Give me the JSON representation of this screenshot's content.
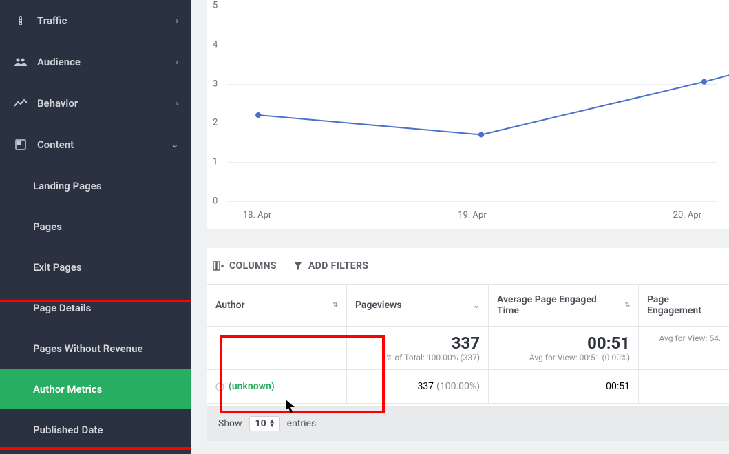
{
  "sidebar": {
    "items": [
      {
        "label": "Traffic",
        "expandable": true,
        "expanded": false
      },
      {
        "label": "Audience",
        "expandable": true,
        "expanded": false
      },
      {
        "label": "Behavior",
        "expandable": true,
        "expanded": false
      },
      {
        "label": "Content",
        "expandable": true,
        "expanded": true
      }
    ],
    "sub": [
      {
        "label": "Landing Pages"
      },
      {
        "label": "Pages"
      },
      {
        "label": "Exit Pages"
      },
      {
        "label": "Page Details"
      },
      {
        "label": "Pages Without Revenue"
      },
      {
        "label": "Author Metrics",
        "active": true
      },
      {
        "label": "Published Date"
      }
    ]
  },
  "toolbar": {
    "columns_label": "COLUMNS",
    "filters_label": "ADD FILTERS"
  },
  "table": {
    "headers": [
      "Author",
      "Pageviews",
      "Average Page Engaged Time",
      "Page Engagement"
    ],
    "summary": {
      "pageviews": {
        "big": "337",
        "sub": "% of Total: 100.00% (337)"
      },
      "avg_time": {
        "big": "00:51",
        "sub": "Avg for View: 00:51 (0.00%)"
      },
      "engagement": {
        "big": "",
        "sub": "Avg for View: 54."
      }
    },
    "rows": [
      {
        "author": "(unknown)",
        "pageviews": "337",
        "pageviews_pct": "(100.00%)",
        "avg_time": "00:51"
      }
    ],
    "footer": {
      "show": "Show",
      "value": "10",
      "entries": "entries"
    }
  },
  "chart_data": {
    "type": "line",
    "title": "",
    "xlabel": "",
    "ylabel": "",
    "ylim": [
      0,
      5
    ],
    "yticks": [
      0,
      1,
      2,
      3,
      4,
      5
    ],
    "categories": [
      "18. Apr",
      "19. Apr",
      "20. Apr"
    ],
    "series": [
      {
        "name": "",
        "values": [
          2.2,
          1.7,
          3.05
        ]
      }
    ]
  }
}
